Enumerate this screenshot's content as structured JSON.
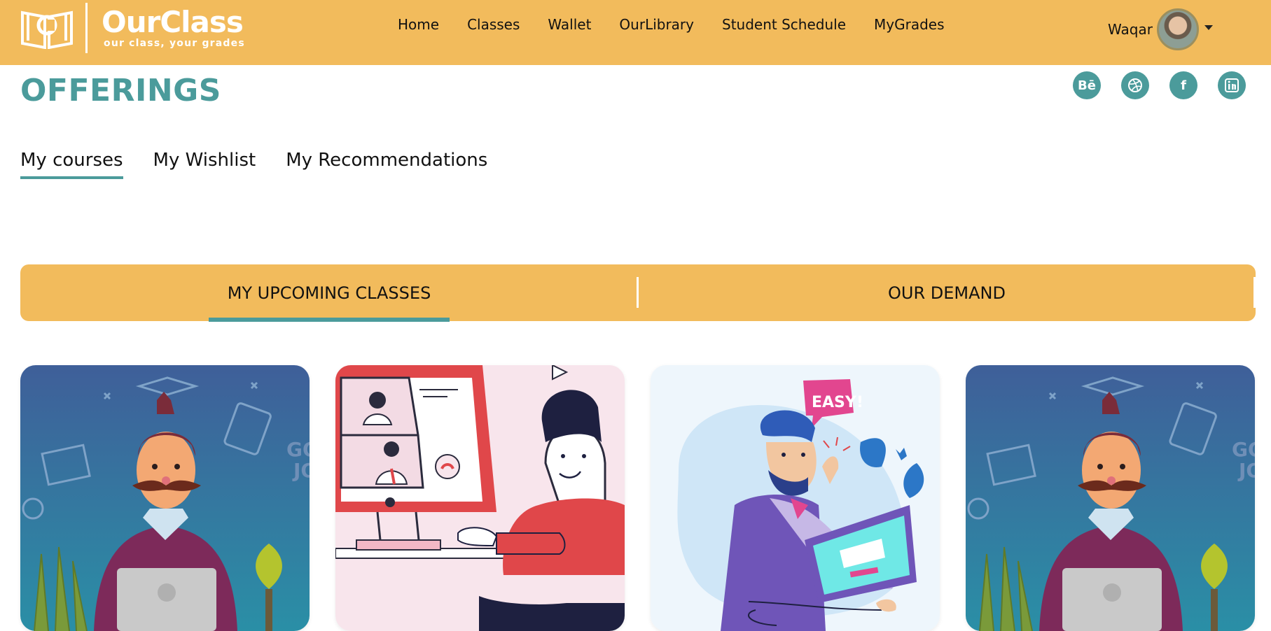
{
  "header": {
    "logo_name": "OurClass",
    "logo_tagline": "our class, your grades",
    "nav": [
      "Home",
      "Classes",
      "Wallet",
      "OurLibrary",
      "Student Schedule",
      "MyGrades"
    ],
    "user_name": "Waqar"
  },
  "page": {
    "title": "OFFERINGS",
    "social": [
      "Bē",
      "dribbble",
      "f",
      "in"
    ]
  },
  "course_tabs": [
    "My courses",
    "My Wishlist",
    "My Recommendations"
  ],
  "class_banner": {
    "left": "MY UPCOMING CLASSES",
    "right": "OUR DEMAND"
  },
  "cards": [
    {
      "illustration": "teacher-with-laptop",
      "badge": "GOOD JOB"
    },
    {
      "illustration": "video-call-computer"
    },
    {
      "illustration": "man-at-computer",
      "badge": "EASY!"
    },
    {
      "illustration": "teacher-with-laptop",
      "badge": "GOOD JOB"
    }
  ],
  "colors": {
    "accent": "#f2bb5c",
    "teal": "#4b9b9b"
  }
}
